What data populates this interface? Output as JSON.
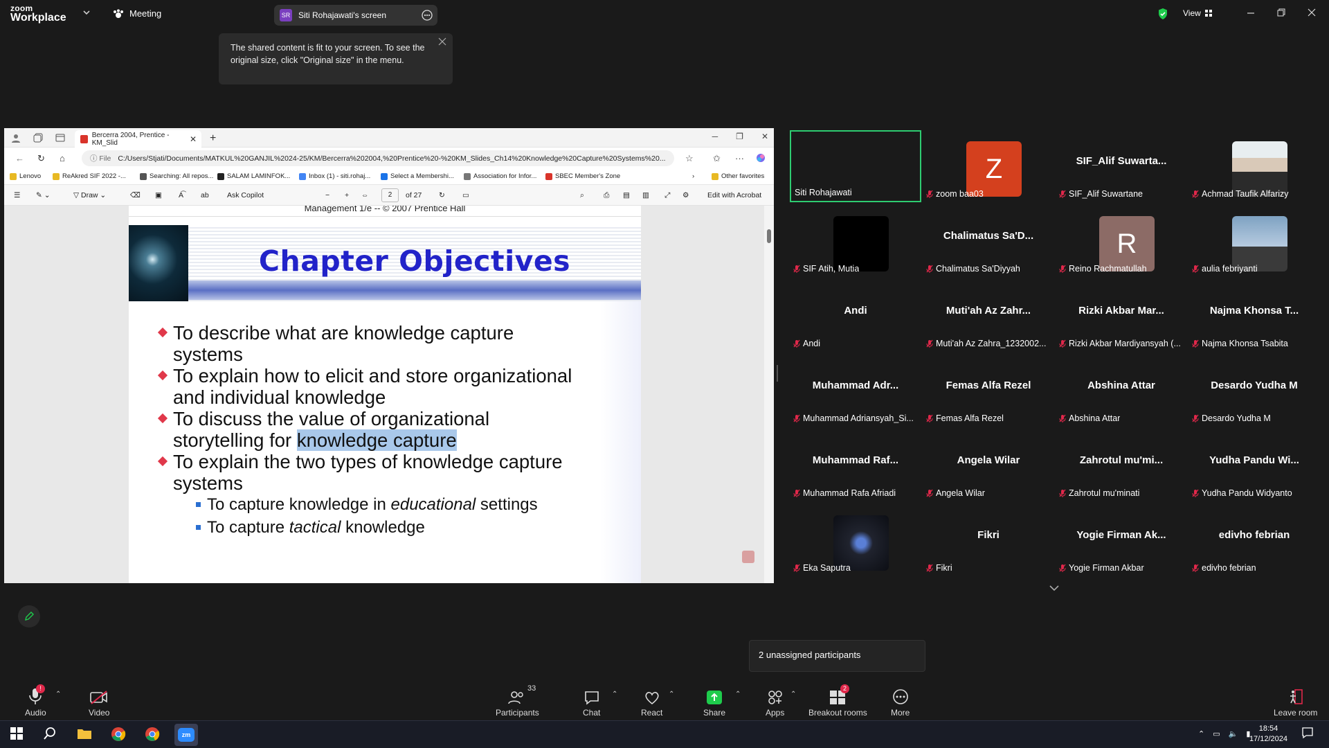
{
  "app": {
    "logo_line1": "zoom",
    "logo_line2": "Workplace",
    "meeting_label": "Meeting",
    "share_pill": {
      "avatar": "SR",
      "label": "Siti Rohajawati's screen"
    },
    "view_label": "View"
  },
  "tooltip": {
    "text": "The shared content is fit to your screen. To see the original size, click \"Original size\" in the menu."
  },
  "browser": {
    "tab_title": "Bercerra 2004, Prentice - KM_Slid",
    "url_prefix": "File",
    "url": "C:/Users/Stjati/Documents/MATKUL%20GANJIL%2024-25/KM/Bercerra%202004,%20Prentice%20-%20KM_Slides_Ch14%20Knowledge%20Capture%20Systems%20...",
    "favorites": [
      {
        "label": "Lenovo",
        "color": "#e8b923"
      },
      {
        "label": "ReAkred SIF 2022 -...",
        "color": "#e8b923"
      },
      {
        "label": "Searching: All repos...",
        "color": "#555555"
      },
      {
        "label": "SALAM LAMINFOK...",
        "color": "#222222"
      },
      {
        "label": "Inbox (1) - siti.rohaj...",
        "color": "#4285f4"
      },
      {
        "label": "Select a Membershi...",
        "color": "#1a73e8"
      },
      {
        "label": "Association for Infor...",
        "color": "#777777"
      },
      {
        "label": "SBEC Member's Zone",
        "color": "#d9342b"
      }
    ],
    "other_favorites": "Other favorites"
  },
  "pdf": {
    "toolbar": {
      "draw": "Draw",
      "ask_copilot": "Ask Copilot",
      "page": "2",
      "page_total": "of 27",
      "edit_acrobat": "Edit with Acrobat"
    },
    "slide_top_text": "Management 1/e -- © 2007 Prentice Hall",
    "title": "Chapter Objectives",
    "bullets": [
      {
        "l1": "To describe what are knowledge capture",
        "l2": "systems"
      },
      {
        "l1": "To explain how to elicit and store organizational",
        "l2": "and individual knowledge"
      },
      {
        "l1": "To discuss the value of organizational",
        "l2a": "storytelling for ",
        "l2b": "knowledge capture"
      },
      {
        "l1": "To explain the two types of  knowledge capture",
        "l2": "systems"
      }
    ],
    "subbullets": [
      {
        "a": "To capture knowledge in ",
        "b": "educational",
        "c": " settings"
      },
      {
        "a": "To capture ",
        "b": "tactical",
        "c": " knowledge"
      }
    ]
  },
  "participants_gallery": [
    {
      "name": "Siti Rohajawati",
      "big": "",
      "muted": false,
      "active": true,
      "avatar": ""
    },
    {
      "name": "zoom baa03",
      "big": "",
      "muted": true,
      "avatar": "Z",
      "avatar_color": "#d4401e"
    },
    {
      "name": "SIF_Alif Suwartane",
      "big": "SIF_Alif  Suwarta...",
      "muted": true
    },
    {
      "name": "Achmad Taufik Alfarizy",
      "big": "",
      "muted": true,
      "avatar": "",
      "photo": "person"
    },
    {
      "name": "SIF Atih, Mutia",
      "big": "",
      "muted": true,
      "photo": "black"
    },
    {
      "name": "Chalimatus Sa'Diyyah",
      "big": "Chalimatus  Sa'D...",
      "muted": true
    },
    {
      "name": "Reino Rachmatullah",
      "big": "",
      "muted": true,
      "avatar": "R",
      "avatar_color": "#8c6b66"
    },
    {
      "name": "aulia febriyanti",
      "big": "",
      "muted": true,
      "photo": "sky"
    },
    {
      "name": "Andi",
      "big": "Andi",
      "muted": true
    },
    {
      "name": "Muti'ah Az Zahra_1232002...",
      "big": "Muti'ah Az Zahr...",
      "muted": true
    },
    {
      "name": "Rizki Akbar Mardiyansyah (...",
      "big": "Rizki Akbar Mar...",
      "muted": true
    },
    {
      "name": "Najma Khonsa Tsabita",
      "big": "Najma Khonsa T...",
      "muted": true
    },
    {
      "name": "Muhammad Adriansyah_Si...",
      "big": "Muhammad Adr...",
      "muted": true
    },
    {
      "name": "Femas Alfa Rezel",
      "big": "Femas Alfa Rezel",
      "muted": true
    },
    {
      "name": "Abshina Attar",
      "big": "Abshina Attar",
      "muted": true
    },
    {
      "name": "Desardo Yudha M",
      "big": "Desardo Yudha M",
      "muted": true
    },
    {
      "name": "Muhammad Rafa Afriadi",
      "big": "Muhammad Raf...",
      "muted": true
    },
    {
      "name": "Angela Wilar",
      "big": "Angela Wilar",
      "muted": true
    },
    {
      "name": "Zahrotul mu'minati",
      "big": "Zahrotul mu'mi...",
      "muted": true
    },
    {
      "name": "Yudha Pandu Widyanto",
      "big": "Yudha Pandu Wi...",
      "muted": true
    },
    {
      "name": "Eka Saputra",
      "big": "",
      "muted": true,
      "photo": "anime"
    },
    {
      "name": "Fikri",
      "big": "Fikri",
      "muted": true
    },
    {
      "name": "Yogie Firman Akbar",
      "big": "Yogie Firman Ak...",
      "muted": true
    },
    {
      "name": "edivho febrian",
      "big": "edivho febrian",
      "muted": true
    }
  ],
  "unassigned": "2 unassigned participants",
  "controls": {
    "audio": "Audio",
    "audio_badge": "!",
    "video": "Video",
    "participants": "Participants",
    "participants_count": "33",
    "chat": "Chat",
    "react": "React",
    "share": "Share",
    "apps": "Apps",
    "breakout": "Breakout rooms",
    "breakout_badge": "2",
    "more": "More",
    "leave": "Leave room"
  },
  "taskbar": {
    "time": "18:54",
    "date": "17/12/2024"
  },
  "colors": {
    "accent_green": "#2ecc71",
    "share_green": "#1ecc4c",
    "mute_red": "#e0284a",
    "slide_title_blue": "#2223c9"
  }
}
